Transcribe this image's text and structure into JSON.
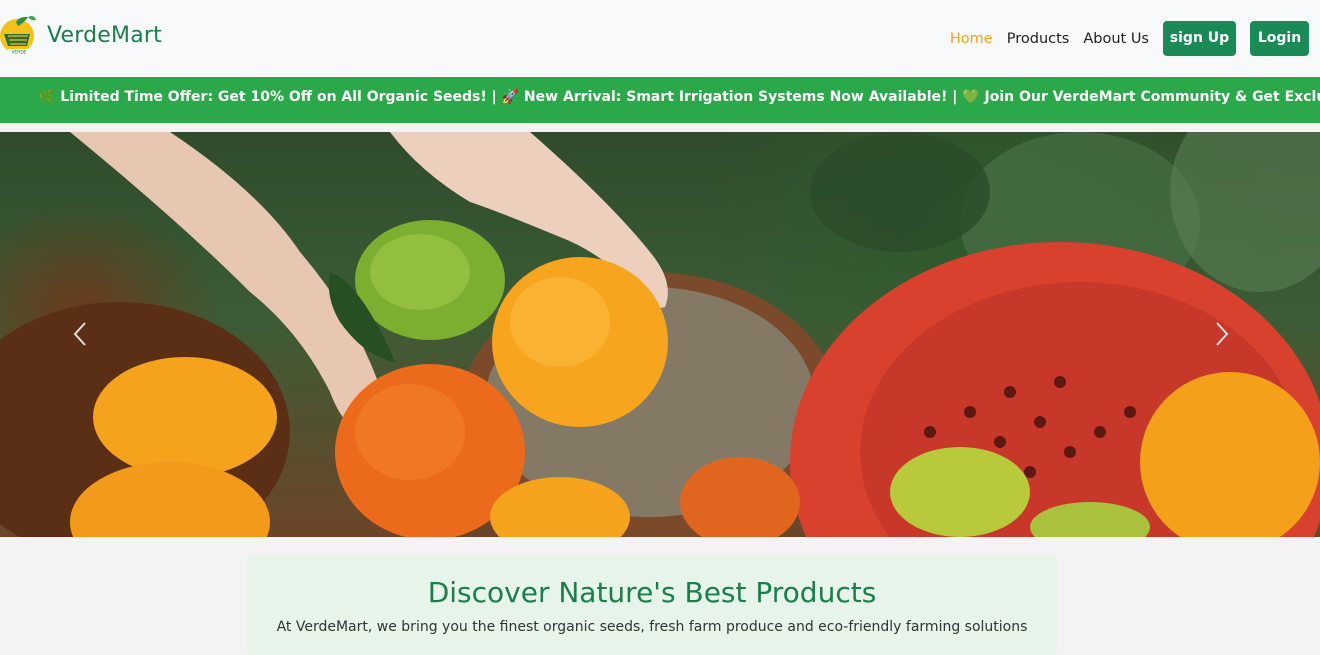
{
  "header": {
    "brand": "VerdeMart",
    "logo_text": "VERDE"
  },
  "nav": {
    "home": "Home",
    "products": "Products",
    "about": "About Us",
    "signup": "sign Up",
    "login": "Login"
  },
  "ticker": {
    "text": "🌿 Limited Time Offer: Get 10% Off on All Organic Seeds! | 🚀 New Arrival: Smart Irrigation Systems Now Available! | 💚 Join Our VerdeMart Community & Get Exclusive Discounts"
  },
  "hero": {
    "prev_icon": "chevron-left-icon",
    "next_icon": "chevron-right-icon"
  },
  "intro": {
    "title": "Discover Nature's Best Products",
    "description": "At VerdeMart, we bring you the finest organic seeds, fresh farm produce and eco-friendly farming solutions"
  },
  "colors": {
    "brand_green": "#1a8a57",
    "ticker_green": "#2ba84a",
    "active_link": "#f4a51c"
  }
}
